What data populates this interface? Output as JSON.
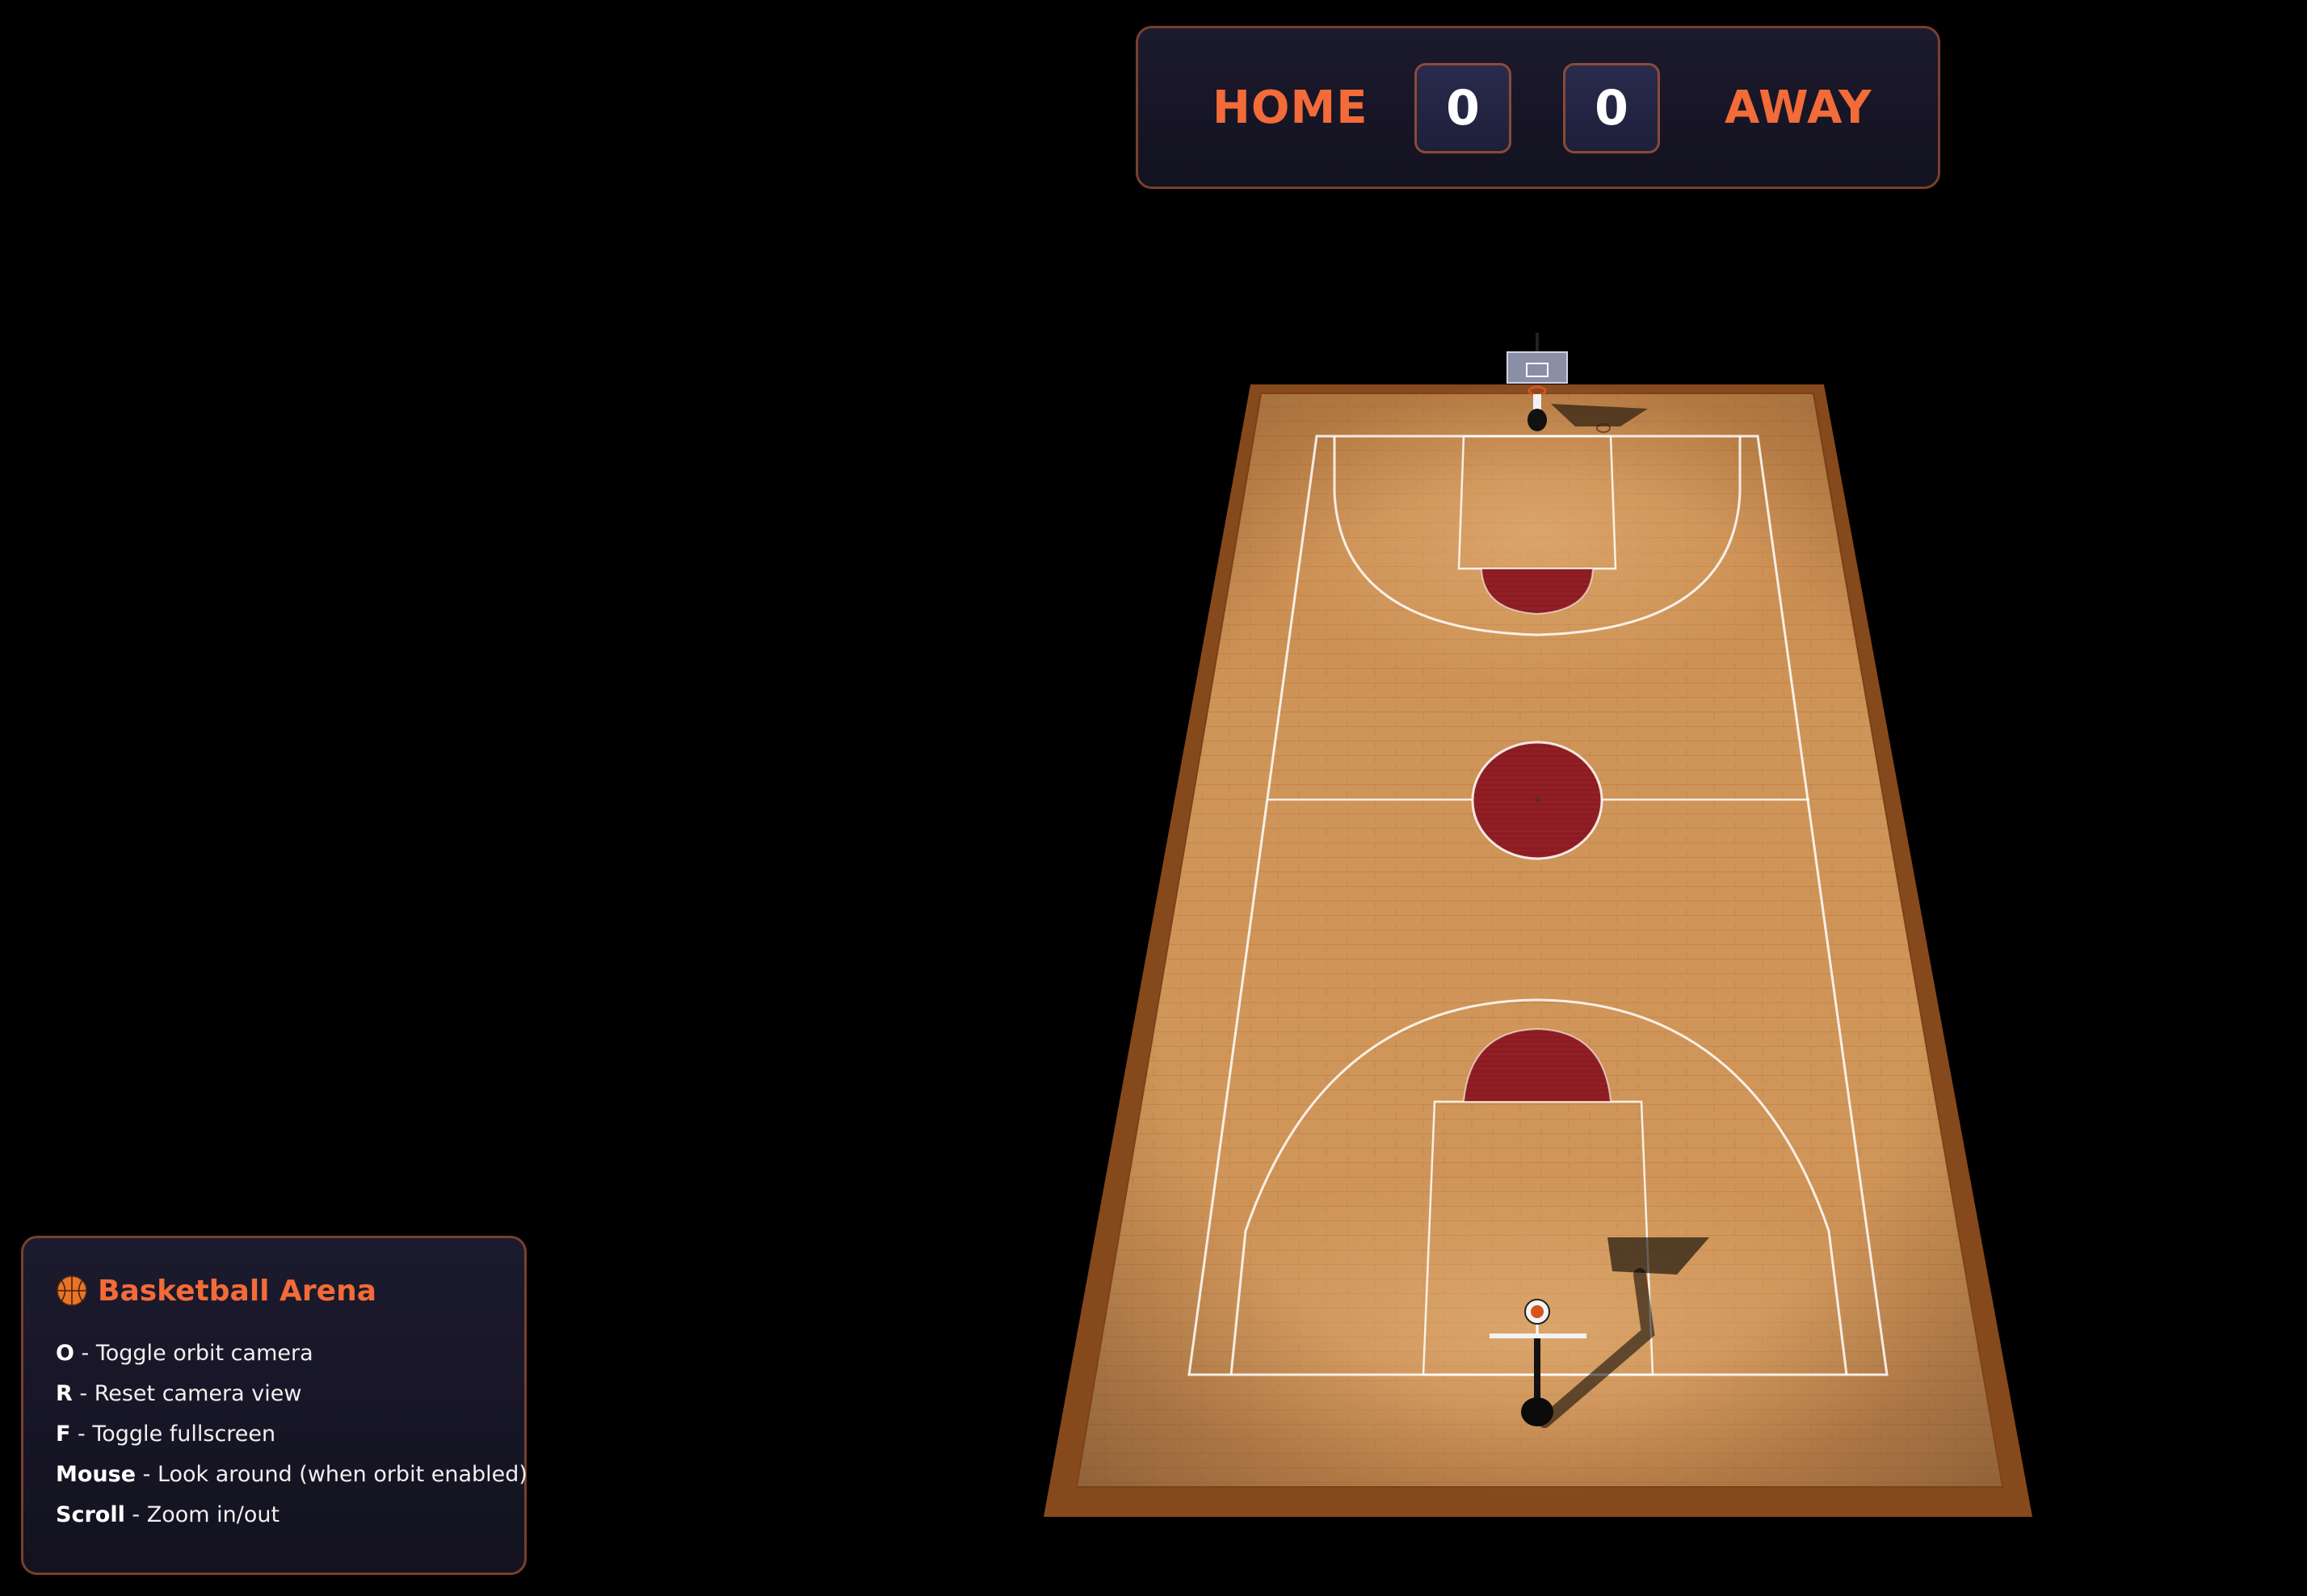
{
  "scoreboard": {
    "home_label": "HOME",
    "away_label": "AWAY",
    "home_score": "0",
    "away_score": "0"
  },
  "controls": {
    "title": "Basketball Arena",
    "title_icon": "basketball-icon",
    "items": [
      {
        "key": "O",
        "desc": " - Toggle orbit camera"
      },
      {
        "key": "R",
        "desc": " - Reset camera view"
      },
      {
        "key": "F",
        "desc": " - Toggle fullscreen"
      },
      {
        "key": "Mouse",
        "desc": " - Look around (when orbit enabled)"
      },
      {
        "key": "Scroll",
        "desc": " - Zoom in/out"
      }
    ]
  },
  "colors": {
    "accent": "#f26b38",
    "panel_border": "#7a3f2e",
    "panel_bg": "#17162a",
    "court_wood": "#c98a4e",
    "court_border": "#8a4e20",
    "paint_red": "#8e1e22",
    "background": "#000000"
  }
}
